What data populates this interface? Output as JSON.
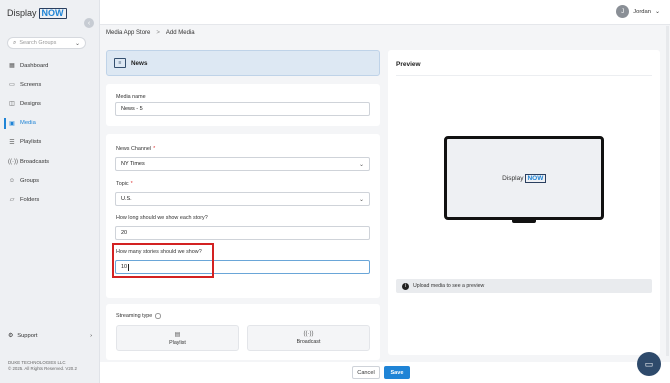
{
  "app": {
    "logo_text": "Display",
    "logo_badge": "NOW"
  },
  "sidebar": {
    "search_placeholder": "Search Groups",
    "items": [
      {
        "label": "Dashboard",
        "icon": "dashboard-icon"
      },
      {
        "label": "Screens",
        "icon": "screens-icon"
      },
      {
        "label": "Designs",
        "icon": "designs-icon"
      },
      {
        "label": "Media",
        "icon": "media-icon",
        "active": true
      },
      {
        "label": "Playlists",
        "icon": "playlists-icon"
      },
      {
        "label": "Broadcasts",
        "icon": "broadcasts-icon"
      },
      {
        "label": "Groups",
        "icon": "groups-icon"
      },
      {
        "label": "Folders",
        "icon": "folders-icon"
      }
    ],
    "support_label": "Support",
    "copyright_line1": "DUKE TECHNOLOGIES LLC",
    "copyright_line2": "© 2025. All Rights Reserved. V20.2"
  },
  "header": {
    "user_initial": "J",
    "user_name": "Jordan"
  },
  "breadcrumb": {
    "root": "Media App Store",
    "separator": ">",
    "current": "Add Media"
  },
  "media_type": {
    "title": "News"
  },
  "form": {
    "media_name_label": "Media name",
    "media_name_value": "News - 5",
    "news_channel_label": "News Channel",
    "news_channel_value": "NY Times",
    "topic_label": "Topic",
    "topic_value": "U.S.",
    "story_duration_label": "How long should we show each story?",
    "story_duration_value": "20",
    "story_count_label": "How many stories should we show?",
    "story_count_value": "10",
    "required_mark": "*"
  },
  "streaming": {
    "label": "Streaming type",
    "options": [
      {
        "label": "Playlist",
        "icon": "playlist-icon"
      },
      {
        "label": "Broadcast",
        "icon": "broadcast-icon"
      }
    ]
  },
  "preview": {
    "title": "Preview",
    "screen_text": "Display",
    "screen_badge": "NOW",
    "upload_hint": "Upload media to see a preview"
  },
  "actions": {
    "cancel": "Cancel",
    "save": "Save"
  },
  "colors": {
    "accent": "#1f84d6",
    "highlight": "#d32222"
  }
}
